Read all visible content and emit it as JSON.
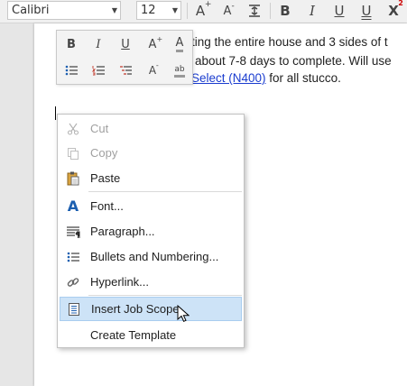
{
  "toolbar": {
    "font_name": "Calibri",
    "font_size": "12",
    "buttons": [
      "A",
      "A",
      "",
      "B",
      "I",
      "U",
      "U",
      "X"
    ],
    "superscript": "2"
  },
  "document": {
    "line1": "ting the entire house and 3 sides of t",
    "line2": "about 7-8 days to complete. Will use",
    "line3_link": "Select (N400)",
    "line3_rest": " for all stucco."
  },
  "mini_toolbar": {
    "row1": [
      "B",
      "I",
      "U",
      "A",
      "A"
    ],
    "row2": [
      "",
      "",
      "",
      "A",
      "ab"
    ]
  },
  "context_menu": {
    "items": [
      {
        "label": "Cut",
        "icon": "scissors-icon",
        "disabled": true
      },
      {
        "label": "Copy",
        "icon": "copy-icon",
        "disabled": true
      },
      {
        "label": "Paste",
        "icon": "paste-icon",
        "disabled": false
      },
      {
        "label": "Font...",
        "icon": "font-icon",
        "disabled": false
      },
      {
        "label": "Paragraph...",
        "icon": "paragraph-icon",
        "disabled": false
      },
      {
        "label": "Bullets and Numbering...",
        "icon": "bullets-icon",
        "disabled": false
      },
      {
        "label": "Hyperlink...",
        "icon": "link-icon",
        "disabled": false
      },
      {
        "label": "Insert Job Scope",
        "icon": "insert-scope-icon",
        "disabled": false,
        "hovered": true
      },
      {
        "label": "Create Template",
        "icon": "",
        "disabled": false
      }
    ]
  },
  "colors": {
    "link": "#1a3ccf",
    "hover": "#cde3f7",
    "font_icon": "#1c5fb0"
  }
}
